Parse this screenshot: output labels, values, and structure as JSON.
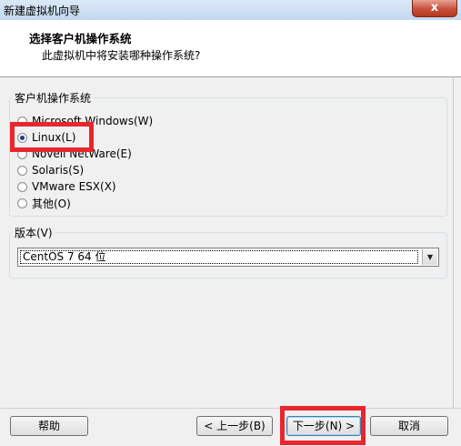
{
  "window": {
    "title": "新建虚拟机向导",
    "close_label": "x"
  },
  "header": {
    "title": "选择客户机操作系统",
    "subtitle": "此虚拟机中将安装哪种操作系统?"
  },
  "os_group": {
    "label": "客户机操作系统",
    "options": [
      {
        "label": "Microsoft Windows(W)",
        "checked": false
      },
      {
        "label": "Linux(L)",
        "checked": true
      },
      {
        "label": "Novell NetWare(E)",
        "checked": false
      },
      {
        "label": "Solaris(S)",
        "checked": false
      },
      {
        "label": "VMware ESX(X)",
        "checked": false
      },
      {
        "label": "其他(O)",
        "checked": false
      }
    ]
  },
  "version_group": {
    "label": "版本(V)",
    "selected": "CentOS 7 64 位"
  },
  "buttons": {
    "help": "帮助",
    "back": "< 上一步(B)",
    "next": "下一步(N) >",
    "cancel": "取消"
  },
  "annotation_color": "#e8262d"
}
